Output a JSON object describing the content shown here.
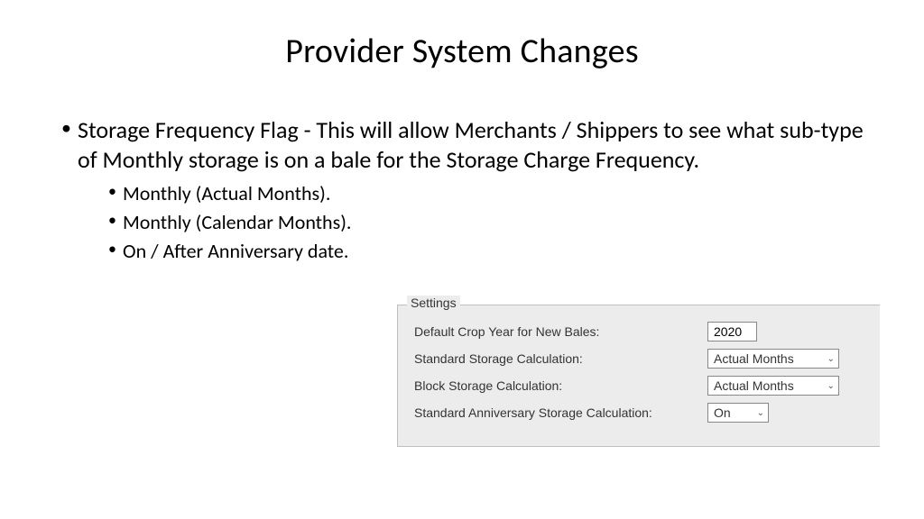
{
  "title": "Provider System Changes",
  "bullets": {
    "main": "Storage Frequency Flag - This will allow Merchants / Shippers to see what sub-type of Monthly storage is on a bale for the Storage Charge Frequency.",
    "sub": [
      "Monthly (Actual Months).",
      "Monthly (Calendar Months).",
      "On / After Anniversary date."
    ]
  },
  "panel": {
    "legend": "Settings",
    "rows": [
      {
        "label": "Default Crop Year for New Bales:",
        "value": "2020",
        "type": "text"
      },
      {
        "label": "Standard Storage Calculation:",
        "value": "Actual Months",
        "type": "combo_wide"
      },
      {
        "label": "Block Storage Calculation:",
        "value": "Actual Months",
        "type": "combo_wide"
      },
      {
        "label": "Standard Anniversary Storage Calculation:",
        "value": "On",
        "type": "combo_narrow"
      }
    ]
  }
}
